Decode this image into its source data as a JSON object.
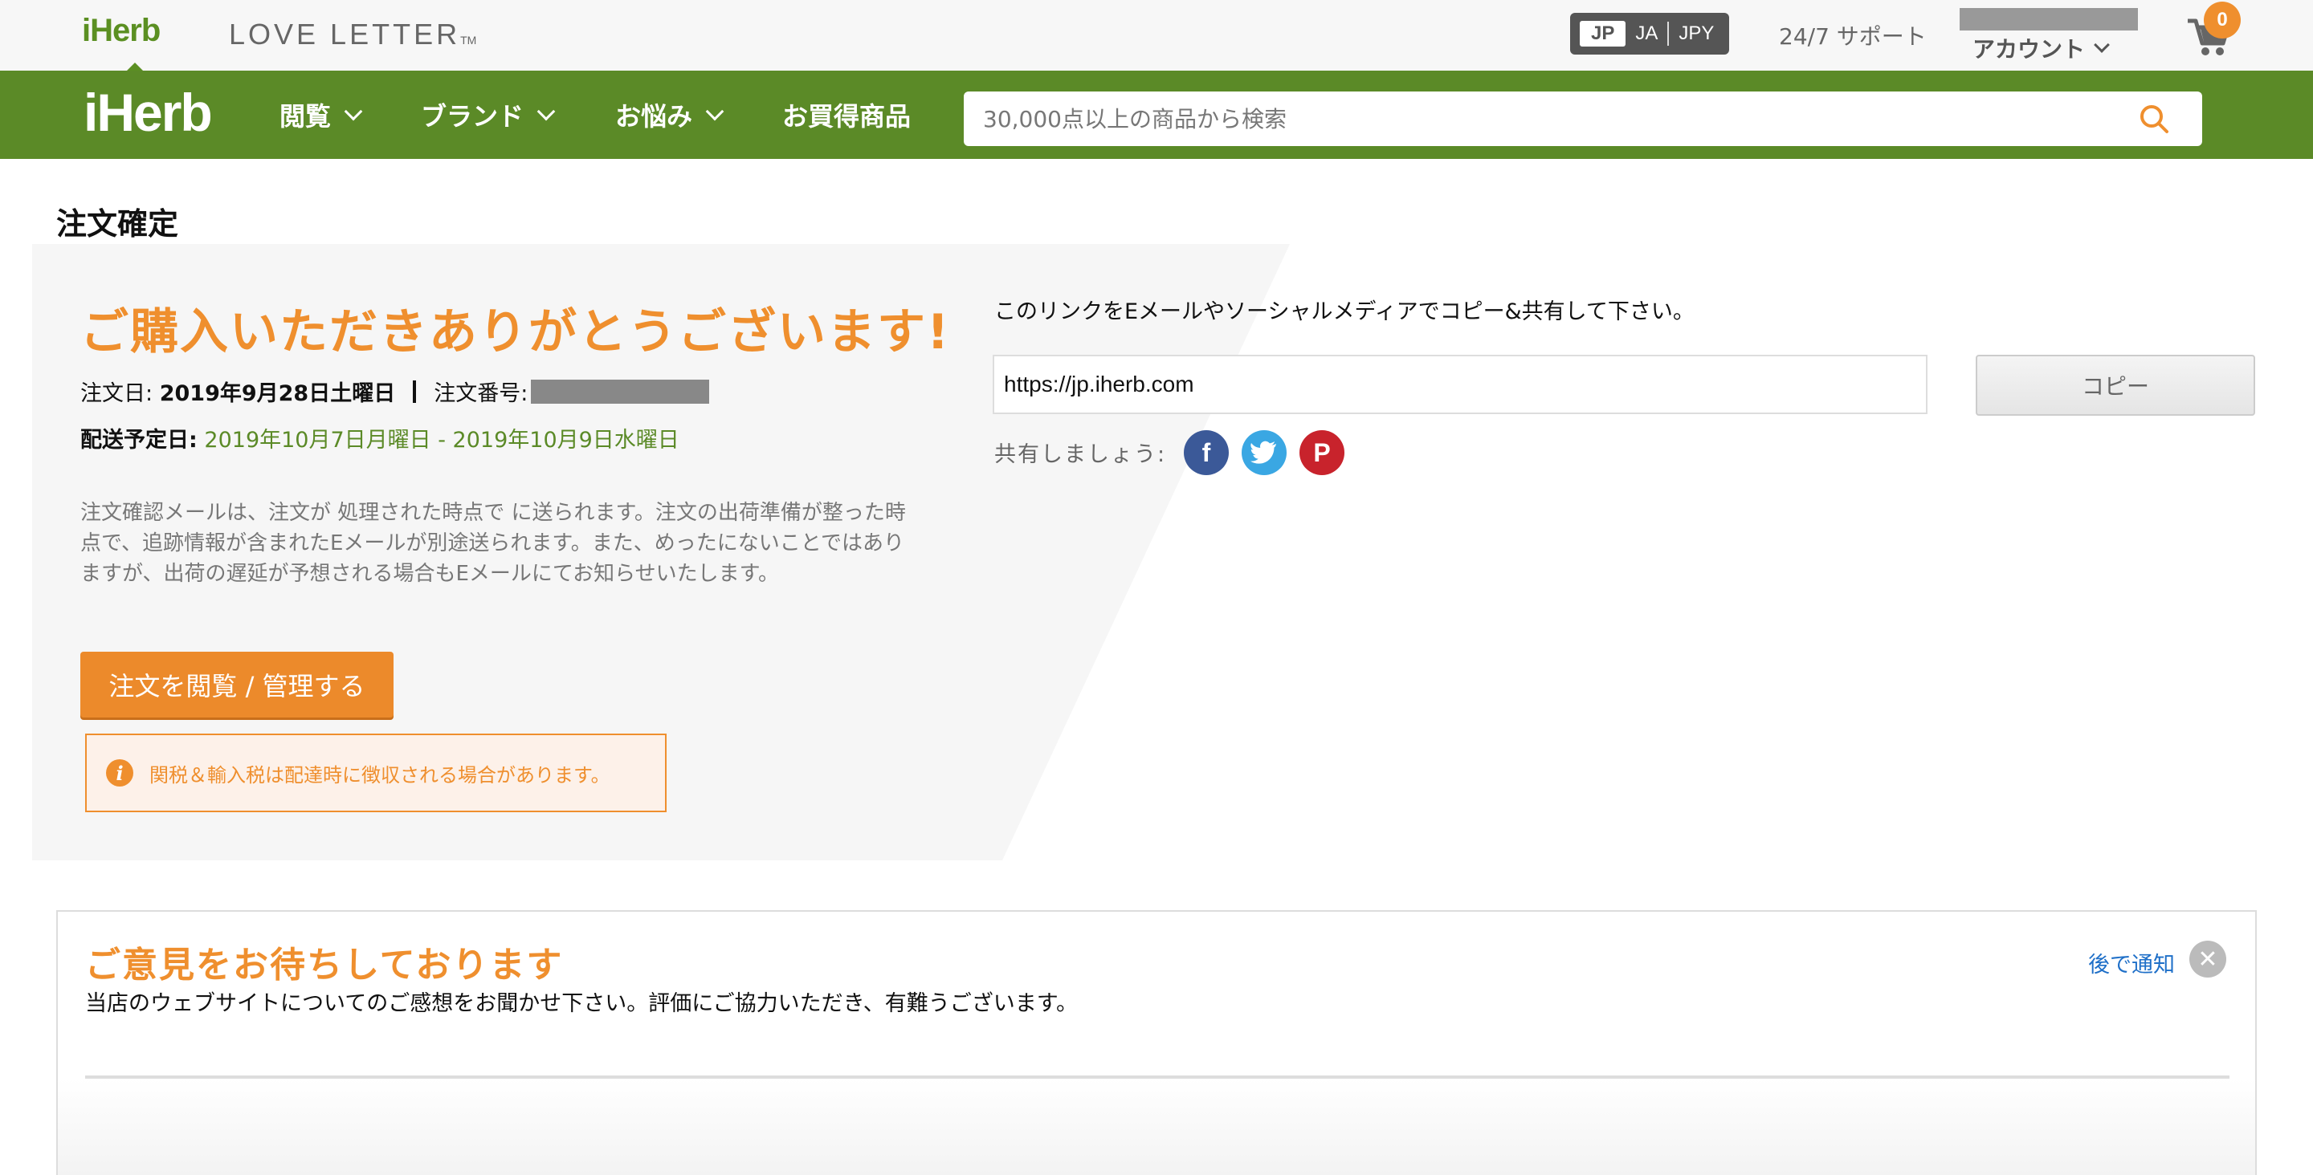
{
  "topbar": {
    "brand_small": "iHerb",
    "love_letter": "LOVE LETTER",
    "love_letter_tm": "TM",
    "locale": {
      "country": "JP",
      "language": "JA",
      "currency": "JPY"
    },
    "support": "24/7 サポート",
    "account": "アカウント",
    "cart_count": "0"
  },
  "nav": {
    "logo": "iHerb",
    "items": [
      {
        "label": "閲覧",
        "has_dropdown": true
      },
      {
        "label": "ブランド",
        "has_dropdown": true
      },
      {
        "label": "お悩み",
        "has_dropdown": true
      },
      {
        "label": "お買得商品",
        "has_dropdown": false
      }
    ],
    "search_placeholder": "30,000点以上の商品から検索"
  },
  "main": {
    "page_title": "注文確定",
    "thanks": "ご購入いただきありがとうございます!",
    "order_date_label": "注文日:",
    "order_date": "2019年9月28日土曜日",
    "order_number_label": "注文番号:",
    "delivery_label": "配送予定日:",
    "delivery_range": "2019年10月7日月曜日 - 2019年10月9日水曜日",
    "confirmation_text": "注文確認メールは、注文が 処理された時点で に送られます。注文の出荷準備が整った時点で、追跡情報が含まれたEメールが別途送られます。また、めったにないことではありますが、出荷の遅延が予想される場合もEメールにてお知らせいたします。",
    "manage_button": "注文を閲覧 / 管理する",
    "notice": "関税＆輸入税は配達時に徴収される場合があります。"
  },
  "share": {
    "instruction": "このリンクをEメールやソーシャルメディアでコピー&共有して下さい。",
    "link_value": "https://jp.iherb.com",
    "copy_button": "コピー",
    "share_label": "共有しましょう:",
    "facebook_glyph": "f",
    "twitter_glyph": "t",
    "pinterest_glyph": "P"
  },
  "feedback": {
    "title": "ご意見をお待ちしております",
    "subtitle": "当店のウェブサイトについてのご感想をお聞かせ下さい。評価にご協力いただき、有難うございます。",
    "later_link": "後で通知"
  },
  "colors": {
    "brand_green": "#5b8a27",
    "accent_orange": "#ef8f2e",
    "link_blue": "#1e6fc8"
  }
}
